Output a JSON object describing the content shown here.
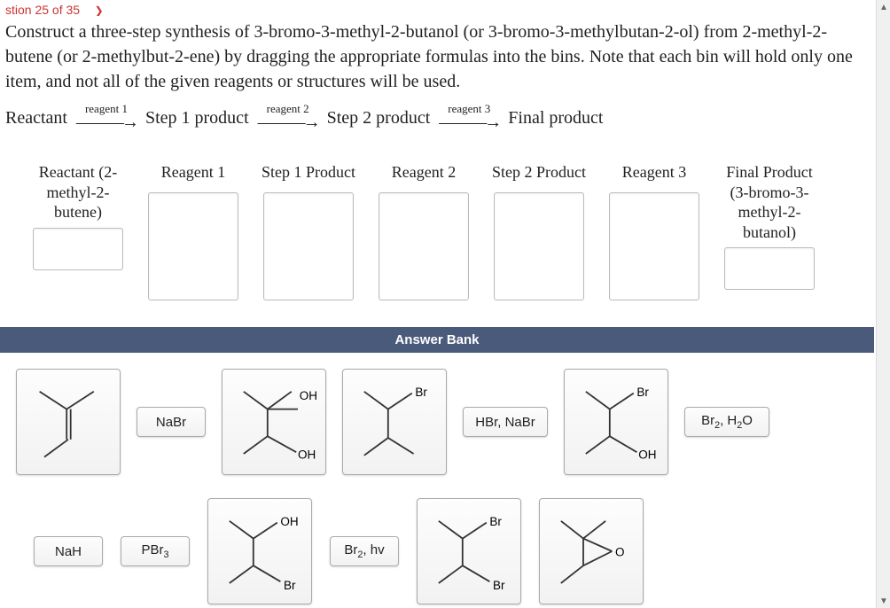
{
  "breadcrumb": "stion 25 of 35",
  "instruction": "Construct a three-step synthesis of 3-bromo-3-methyl-2-butanol (or 3-bromo-3-methylbutan-2-ol) from 2-methyl-2-butene (or 2-methylbut-2-ene) by dragging the appropriate formulas into the bins. Note that each bin will hold only one item, and not all of the given reagents or structures will be used.",
  "scheme": {
    "reactant": "Reactant",
    "r1": "reagent 1",
    "p1": "Step 1 product",
    "r2": "reagent 2",
    "p2": "Step 2 product",
    "r3": "reagent 3",
    "pf": "Final product"
  },
  "bins": [
    {
      "label": "Reactant (2-methyl-2-butene)"
    },
    {
      "label": "Reagent 1"
    },
    {
      "label": "Step 1 Product"
    },
    {
      "label": "Reagent 2"
    },
    {
      "label": "Step 2 Product"
    },
    {
      "label": "Reagent 3"
    },
    {
      "label": "Final Product (3-bromo-3-methyl-2-butanol)"
    }
  ],
  "answer_bank_title": "Answer Bank",
  "tiles": {
    "nabr": "NaBr",
    "hbr_nabr": "HBr, NaBr",
    "br2_h2o": "Br₂, H₂O",
    "nah": "NaH",
    "pbr3": "PBr₃",
    "br2_hv": "Br₂, hv"
  },
  "labels": {
    "oh": "OH",
    "br": "Br",
    "o": "O"
  }
}
